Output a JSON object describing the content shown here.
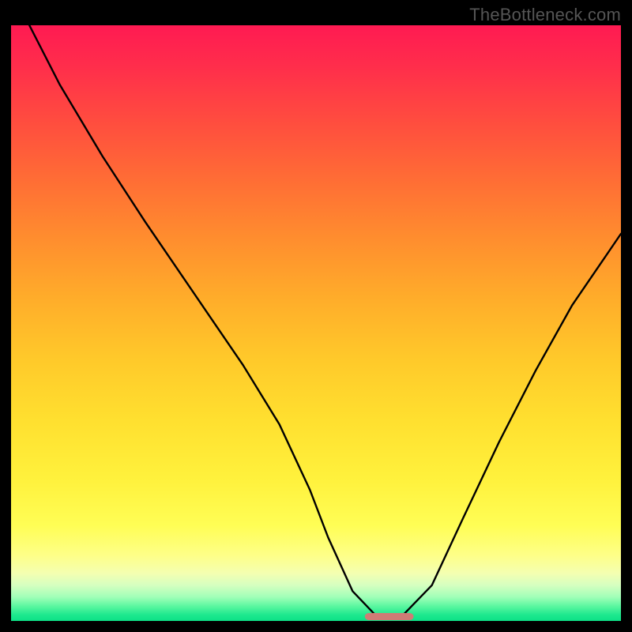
{
  "attribution": "TheBottleneck.com",
  "colors": {
    "frame_bg": "#000000",
    "attribution": "#555555",
    "curve_stroke": "#000000",
    "marker_fill": "#d07b75",
    "gradient_stops": [
      "#ff1a52",
      "#ff2e4b",
      "#ff4c3f",
      "#ff6d35",
      "#ff8e2e",
      "#ffad2a",
      "#ffc92a",
      "#ffdf2f",
      "#fff13c",
      "#fffe55",
      "#feff88",
      "#f4ffb1",
      "#d6ffc0",
      "#a0ffb8",
      "#5cf7a0",
      "#1de88e",
      "#0de187"
    ]
  },
  "chart_data": {
    "type": "line",
    "title": "",
    "xlabel": "",
    "ylabel": "",
    "xlim": [
      0,
      100
    ],
    "ylim": [
      0,
      100
    ],
    "series": [
      {
        "name": "bottleneck-curve",
        "x": [
          3,
          8,
          15,
          22,
          26,
          32,
          38,
          44,
          49,
          52,
          56,
          60,
          64,
          69,
          74,
          80,
          86,
          92,
          98,
          100
        ],
        "values": [
          100,
          90,
          78,
          67,
          61,
          52,
          43,
          33,
          22,
          14,
          5,
          0.7,
          0.7,
          6,
          17,
          30,
          42,
          53,
          62,
          65
        ]
      }
    ],
    "marker": {
      "x_center": 62,
      "width": 8,
      "height": 1.2
    }
  }
}
